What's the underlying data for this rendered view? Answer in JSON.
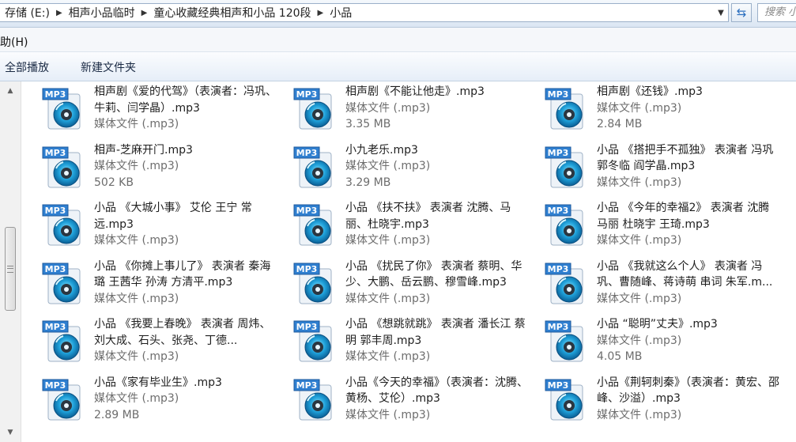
{
  "address_bar": {
    "crumbs": [
      "存储 (E:)",
      "相声小品临时",
      "童心收藏经典相声和小品 120段",
      "小品"
    ],
    "search_placeholder": "搜索 小品"
  },
  "menubar": {
    "help_label": "助(H)"
  },
  "toolbar": {
    "play_all_label": "全部播放",
    "new_folder_label": "新建文件夹"
  },
  "files": [
    {
      "name": "相声剧《爱的代驾》（表演者：冯巩、牛莉、闫学晶）.mp3",
      "type": "媒体文件 (.mp3)",
      "size": ""
    },
    {
      "name": "相声剧《不能让他走》.mp3",
      "type": "媒体文件 (.mp3)",
      "size": "3.35 MB"
    },
    {
      "name": "相声剧《还钱》.mp3",
      "type": "媒体文件 (.mp3)",
      "size": "2.84 MB"
    },
    {
      "name": "相声-芝麻开门.mp3",
      "type": "媒体文件 (.mp3)",
      "size": "502 KB"
    },
    {
      "name": "小九老乐.mp3",
      "type": "媒体文件 (.mp3)",
      "size": "3.29 MB"
    },
    {
      "name": "小品 《搭把手不孤独》 表演者 冯巩 郭冬临 阎学晶.mp3",
      "type": "媒体文件 (.mp3)",
      "size": ""
    },
    {
      "name": "小品 《大城小事》 艾伦 王宁 常远.mp3",
      "type": "媒体文件 (.mp3)",
      "size": ""
    },
    {
      "name": "小品 《扶不扶》 表演者 沈腾、马丽、杜晓宇.mp3",
      "type": "媒体文件 (.mp3)",
      "size": ""
    },
    {
      "name": "小品 《今年的幸福2》 表演者 沈腾 马丽 杜晓宇 王琦.mp3",
      "type": "媒体文件 (.mp3)",
      "size": ""
    },
    {
      "name": "小品 《你摊上事儿了》 表演者 秦海璐 王茜华 孙涛 方清平.mp3",
      "type": "媒体文件 (.mp3)",
      "size": ""
    },
    {
      "name": "小品 《扰民了你》 表演者 蔡明、华少、大鹏、岳云鹏、穆雪峰.mp3",
      "type": "媒体文件 (.mp3)",
      "size": ""
    },
    {
      "name": "小品 《我就这么个人》 表演者 冯巩、曹随峰、蒋诗萌 串词 朱军.m...",
      "type": "媒体文件 (.mp3)",
      "size": ""
    },
    {
      "name": "小品 《我要上春晚》 表演者 周炜、刘大成、石头、张尧、丁德...",
      "type": "媒体文件 (.mp3)",
      "size": ""
    },
    {
      "name": "小品 《想跳就跳》 表演者 潘长江 蔡明 郭丰周.mp3",
      "type": "媒体文件 (.mp3)",
      "size": ""
    },
    {
      "name": "小品 “聪明”丈夫》.mp3",
      "type": "媒体文件 (.mp3)",
      "size": "4.05 MB"
    },
    {
      "name": "小品《家有毕业生》.mp3",
      "type": "媒体文件 (.mp3)",
      "size": "2.89 MB"
    },
    {
      "name": "小品《今天的幸福》（表演者：沈腾、黄杨、艾伦）.mp3",
      "type": "媒体文件 (.mp3)",
      "size": ""
    },
    {
      "name": "小品《荆轲刺秦》（表演者：黄宏、邵峰、沙溢）.mp3",
      "type": "媒体文件 (.mp3)",
      "size": ""
    }
  ],
  "icon_label": "MP3"
}
